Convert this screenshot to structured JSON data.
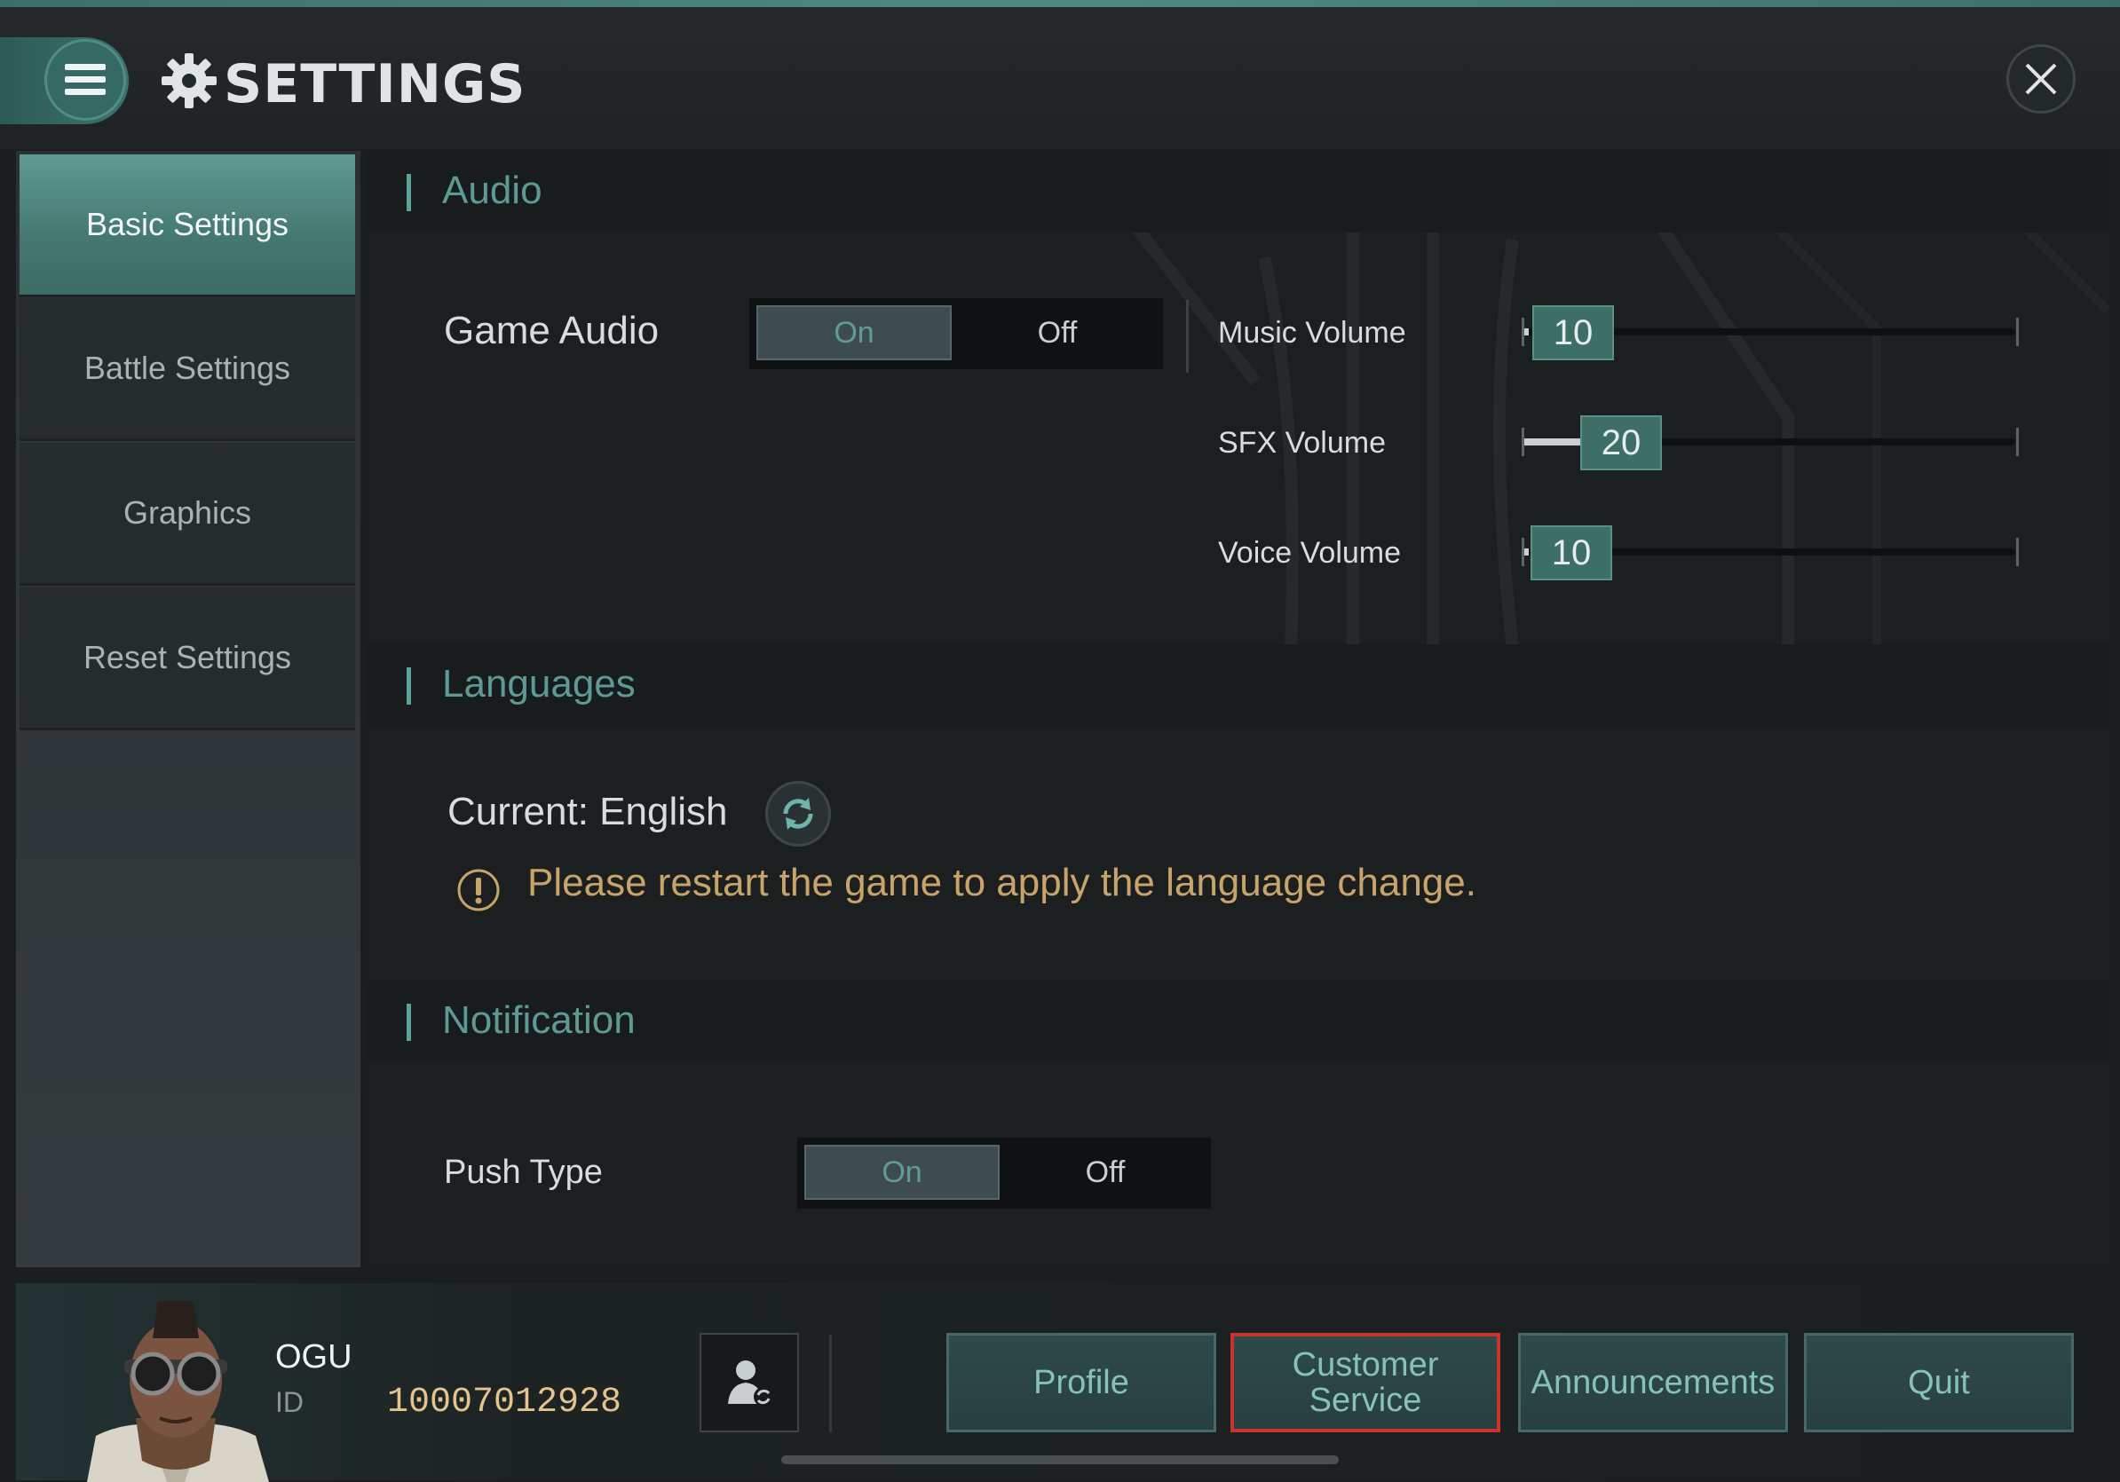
{
  "header": {
    "title": "SETTINGS"
  },
  "sidebar": {
    "items": [
      {
        "label": "Basic Settings",
        "active": true
      },
      {
        "label": "Battle Settings",
        "active": false
      },
      {
        "label": "Graphics",
        "active": false
      },
      {
        "label": "Reset Settings",
        "active": false
      }
    ]
  },
  "audio": {
    "section_title": "Audio",
    "game_audio": {
      "label": "Game Audio",
      "on_label": "On",
      "off_label": "Off",
      "value": "On"
    },
    "music": {
      "label": "Music Volume",
      "value": "10"
    },
    "sfx": {
      "label": "SFX Volume",
      "value": "20"
    },
    "voice": {
      "label": "Voice Volume",
      "value": "10"
    }
  },
  "languages": {
    "section_title": "Languages",
    "current": "Current: English",
    "warning": "Please restart the game to apply the language change."
  },
  "notification": {
    "section_title": "Notification",
    "push_type": {
      "label": "Push Type",
      "on_label": "On",
      "off_label": "Off",
      "value": "On"
    }
  },
  "player": {
    "name": "OGU",
    "id_label": "ID",
    "id_value": "10007012928"
  },
  "bottom_buttons": {
    "profile": "Profile",
    "customer_service_line1": "Customer",
    "customer_service_line2": "Service",
    "announcements": "Announcements",
    "quit": "Quit"
  },
  "icons": {
    "menu": "hamburger-icon",
    "gear": "gear-icon",
    "close": "close-icon",
    "refresh": "refresh-icon",
    "warning": "warning-icon",
    "switch_account": "switch-account-icon"
  },
  "colors": {
    "accent": "#5aa39a",
    "warning": "#c8a46a",
    "highlight_border": "#c8332c",
    "id_value": "#e3c48d"
  }
}
